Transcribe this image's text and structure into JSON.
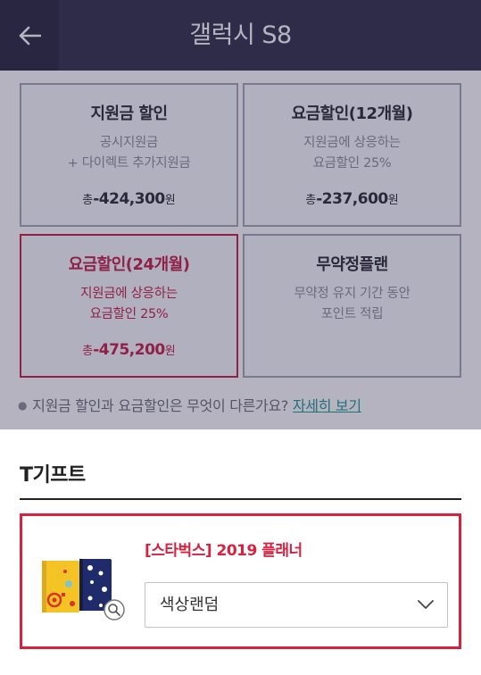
{
  "header": {
    "title": "갤럭시 S8",
    "back_icon": "arrow-left-icon"
  },
  "plans": [
    {
      "title": "지원금 할인",
      "desc_line1": "공시지원금",
      "desc_line2": "+ 다이렉트 추가지원금",
      "total_prefix": "총",
      "total_amount": "-424,300",
      "total_unit": "원",
      "selected": false
    },
    {
      "title": "요금할인(12개월)",
      "desc_line1": "지원금에 상응하는",
      "desc_line2": "요금할인 25%",
      "total_prefix": "총",
      "total_amount": "-237,600",
      "total_unit": "원",
      "selected": false
    },
    {
      "title": "요금할인(24개월)",
      "desc_line1": "지원금에 상응하는",
      "desc_line2": "요금할인 25%",
      "total_prefix": "총",
      "total_amount": "-475,200",
      "total_unit": "원",
      "selected": true
    },
    {
      "title": "무약정플랜",
      "desc_line1": "무약정 유지 기간 동안",
      "desc_line2": "포인트 적립",
      "selected": false
    }
  ],
  "info": {
    "text": "지원금 할인과 요금할인은 무엇이 다른가요?",
    "link": "자세히 보기"
  },
  "gift": {
    "section_title": "T기프트",
    "item_name": "[스타벅스] 2019 플래너",
    "option_value": "색상랜덤",
    "zoom_icon": "magnifier-icon",
    "chevron_icon": "chevron-down-icon"
  },
  "colors": {
    "header_bg": "#34304a",
    "accent_red": "#d8203f",
    "selected_border": "#c81e49",
    "link_teal": "#1f9a95"
  }
}
